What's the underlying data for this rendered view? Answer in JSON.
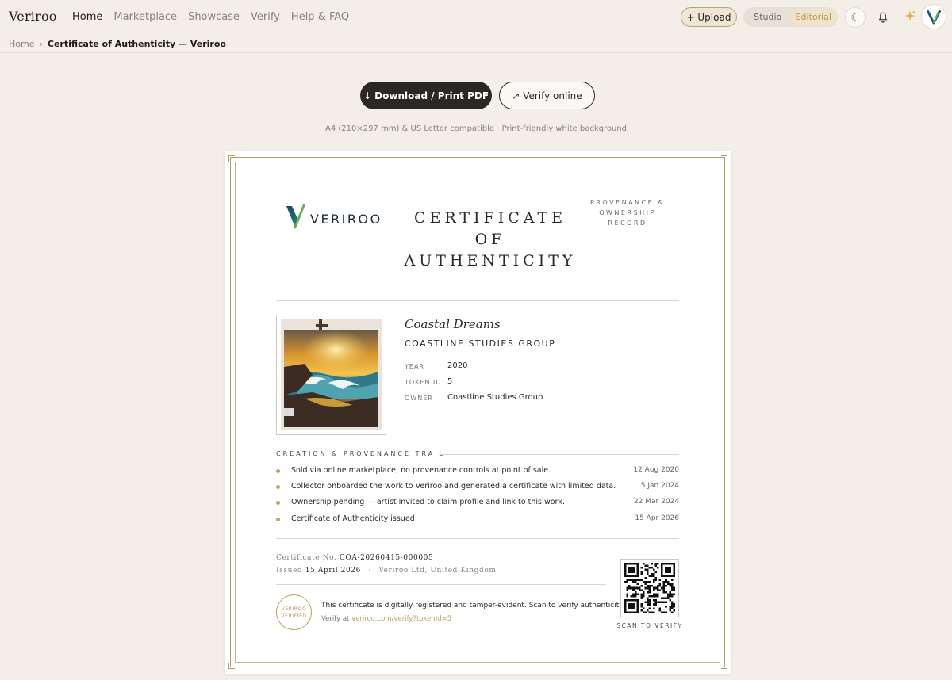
{
  "nav": {
    "brand": "Veriroo",
    "links": [
      "Home",
      "Marketplace",
      "Showcase",
      "Verify",
      "Help & FAQ"
    ],
    "upload": "+ Upload",
    "mode_options": [
      "Studio",
      "Editorial"
    ],
    "mode_selected": "Editorial",
    "theme_icon": "☾",
    "accent": "#b89455"
  },
  "breadcrumb": {
    "home": "Home",
    "separator": "›",
    "current": "Certificate of Authenticity — Veriroo"
  },
  "actions": {
    "download": "↓ Download / Print PDF",
    "verify": "↗ Verify online",
    "compat": "A4 (210×297 mm) & US Letter compatible · Print-friendly white background"
  },
  "certificate": {
    "logo_text": "VERIROO",
    "title_lines": [
      "CERTIFICATE",
      "OF",
      "AUTHENTICITY"
    ],
    "provenance_lines": [
      "PROVENANCE &",
      "OWNERSHIP",
      "RECORD"
    ],
    "artwork": {
      "title": "Coastal Dreams",
      "artist": "COASTLINE STUDIES GROUP",
      "year_label": "YEAR",
      "year": "2020",
      "token_label": "TOKEN ID",
      "token": "5",
      "owner_label": "OWNER",
      "owner": "Coastline Studies Group"
    },
    "trail_heading": "CREATION & PROVENANCE TRAIL",
    "trail": [
      {
        "text": "Sold via online marketplace; no provenance controls at point of sale.",
        "date": "12 Aug 2020"
      },
      {
        "text": "Collector onboarded the work to Veriroo and generated a certificate with limited data.",
        "date": "5 Jan 2024"
      },
      {
        "text": "Ownership pending — artist invited to claim profile and link to this work.",
        "date": "22 Mar 2024"
      },
      {
        "text": "Certificate of Authenticity issued",
        "date": "15 Apr 2026"
      }
    ],
    "cert_no_label": "Certificate No.",
    "cert_no": "COA-20260415-000005",
    "issued_label": "Issued",
    "issued_date": "15 April 2026",
    "issued_sep": "·",
    "issuer": "Veriroo Ltd, United Kingdom",
    "seal_lines": [
      "VERIROO",
      "VERIFIED"
    ],
    "sealed_text": "This certificate is digitally registered and tamper-evident. Scan to verify authenticity.",
    "verify_prefix": "Verify at",
    "verify_link": "veriroo.com/verify?tokenId=5",
    "scan_label": "SCAN TO VERIFY"
  }
}
